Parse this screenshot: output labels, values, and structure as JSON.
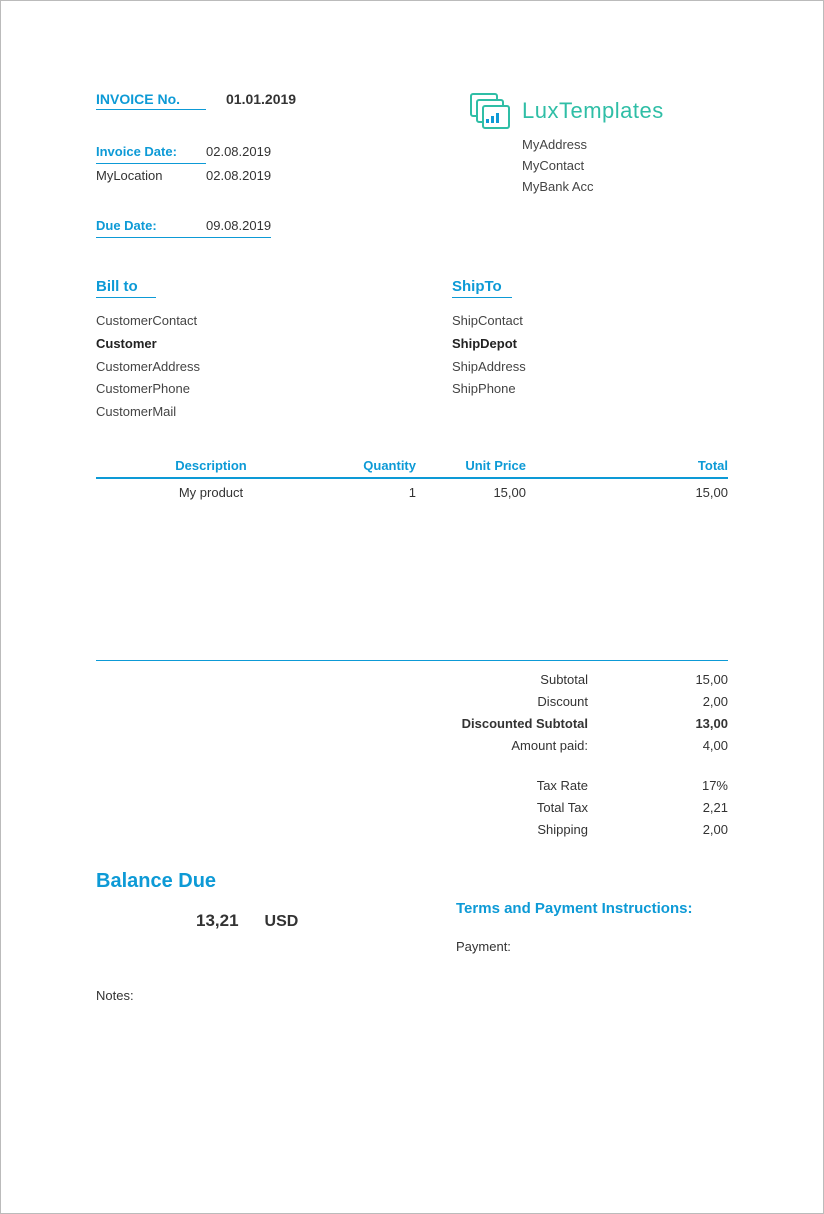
{
  "header": {
    "invoice_no_label": "INVOICE No.",
    "invoice_no_value": "01.01.2019",
    "invoice_date_label": "Invoice Date:",
    "invoice_date_value": "02.08.2019",
    "location_label": "MyLocation",
    "location_value": "02.08.2019",
    "due_date_label": "Due Date:",
    "due_date_value": "09.08.2019"
  },
  "company": {
    "brand": "LuxTemplates",
    "lines": {
      "address": "MyAddress",
      "contact": "MyContact",
      "bank": "MyBank Acc"
    }
  },
  "bill_to": {
    "title": "Bill to",
    "contact": "CustomerContact",
    "name": "Customer",
    "address": "CustomerAddress",
    "phone": "CustomerPhone",
    "mail": "CustomerMail"
  },
  "ship_to": {
    "title": "ShipTo",
    "contact": "ShipContact",
    "name": "ShipDepot",
    "address": "ShipAddress",
    "phone": "ShipPhone"
  },
  "items": {
    "columns": {
      "description": "Description",
      "quantity": "Quantity",
      "unit_price": "Unit Price",
      "total": "Total"
    },
    "rows": [
      {
        "description": "My product",
        "quantity": "1",
        "unit_price": "15,00",
        "total": "15,00"
      }
    ]
  },
  "totals": {
    "subtotal_label": "Subtotal",
    "subtotal_value": "15,00",
    "discount_label": "Discount",
    "discount_value": "2,00",
    "discounted_subtotal_label": "Discounted Subtotal",
    "discounted_subtotal_value": "13,00",
    "amount_paid_label": "Amount paid:",
    "amount_paid_value": "4,00",
    "tax_rate_label": "Tax Rate",
    "tax_rate_value": "17%",
    "total_tax_label": "Total Tax",
    "total_tax_value": "2,21",
    "shipping_label": "Shipping",
    "shipping_value": "2,00"
  },
  "balance": {
    "title": "Balance Due",
    "amount": "13,21",
    "currency": "USD"
  },
  "terms": {
    "title": "Terms and Payment Instructions:",
    "payment_label": "Payment:"
  },
  "notes": {
    "label": "Notes:"
  }
}
